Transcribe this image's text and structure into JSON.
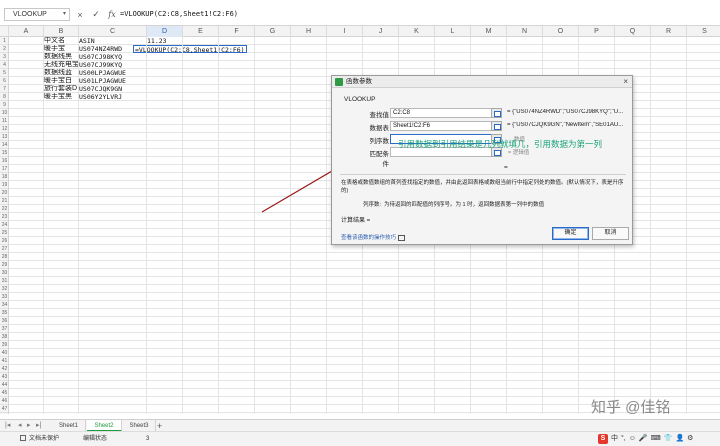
{
  "formula_bar": {
    "name_box": "VLOOKUP",
    "cancel_icon": "×",
    "confirm_icon": "✓",
    "fx_label": "fx",
    "formula": "=VLOOKUP(C2:C8,Sheet1!C2:F6)"
  },
  "columns": [
    "A",
    "B",
    "C",
    "D",
    "E",
    "F",
    "G",
    "H",
    "I",
    "J",
    "K",
    "L",
    "M",
    "N",
    "O",
    "P",
    "Q",
    "R",
    "S"
  ],
  "selected_column": "D",
  "rows": [
    "1",
    "2",
    "3",
    "4",
    "5",
    "6",
    "7",
    "8",
    "9",
    "10",
    "11",
    "12",
    "13",
    "14",
    "15",
    "16",
    "17",
    "18",
    "19",
    "20",
    "21",
    "22",
    "23",
    "24",
    "25",
    "26",
    "27",
    "28",
    "29",
    "30",
    "31",
    "32",
    "33",
    "34",
    "35",
    "36",
    "37",
    "38",
    "39",
    "40",
    "41",
    "42",
    "43",
    "44",
    "45",
    "46",
    "47"
  ],
  "cells": {
    "b1": "中文名",
    "c1": "ASIN",
    "d1": "11.23",
    "b2": "暖手宝",
    "c2": "US074NZ4RWD",
    "b3": "数据线黑",
    "c3": "US07CJ98KYQ",
    "b4": "无线充电宝",
    "c4": "US07CJ99KYQ",
    "b5": "数据线蓝",
    "c5": "US00LPJAGWUE",
    "b6": "暖手宝白",
    "c6": "US01LPJAGWUE",
    "b7": "旅行套装D",
    "c7": "US07CJQK9GN",
    "b8": "暖手宝黑",
    "c8": "US06Y2YLVRJ",
    "d2_editing": "=VLOOKUP(C2:C8,Sheet1!C2:F6)"
  },
  "dialog": {
    "title": "函数参数",
    "close_icon": "×",
    "function_name": "VLOOKUP",
    "args": [
      {
        "label": "查找值",
        "value": "C2:C8",
        "result": "= {\"US074NZ4RWD\";\"US07CJ98KYQ\";\"U..."
      },
      {
        "label": "数据表",
        "value": "Sheet1!C2:F6",
        "result": "= {\"US07CJQK9GN\",\"NewItem\",\"SE01AU..."
      },
      {
        "label": "列序数",
        "value": "",
        "hint": "数值"
      },
      {
        "label": "匹配条件",
        "value": "",
        "hint": "= 逻辑值"
      }
    ],
    "annotation": "引用数据到引用结果是几列就填几，引用数据为第一列",
    "result_eq": "=",
    "description": "在表格或数值数组的首列查找指定的数值，并由此返回表格或数组当前行中指定列处的数值。(默认情况下，表是升序的)",
    "param_name": "列序数:",
    "param_desc": "为待返回的匹配值的列序号。为 1 时，返回数据表第一列中的数值",
    "calc_result": "计算结果 =",
    "help_link": "查看该函数的操作技巧",
    "ok_label": "确定",
    "cancel_label": "取消"
  },
  "sheet_tabs": [
    "Sheet1",
    "Sheet2",
    "Sheet3"
  ],
  "active_sheet": "Sheet2",
  "add_sheet": "+",
  "status": {
    "doc_protect": "文档未保护",
    "mode": "编辑状态",
    "count": "3"
  },
  "ime": {
    "logo": "S",
    "items": [
      "中",
      "°,",
      "☺",
      "🎤",
      "⌨",
      "👕",
      "👤",
      "⚙"
    ]
  },
  "watermark": "知乎 @佳铭",
  "colors": {
    "accent_green": "#1f9a3e",
    "annotation": "#1aa37a",
    "arrow": "#9a1a1a",
    "selection": "#2a6ac8"
  }
}
